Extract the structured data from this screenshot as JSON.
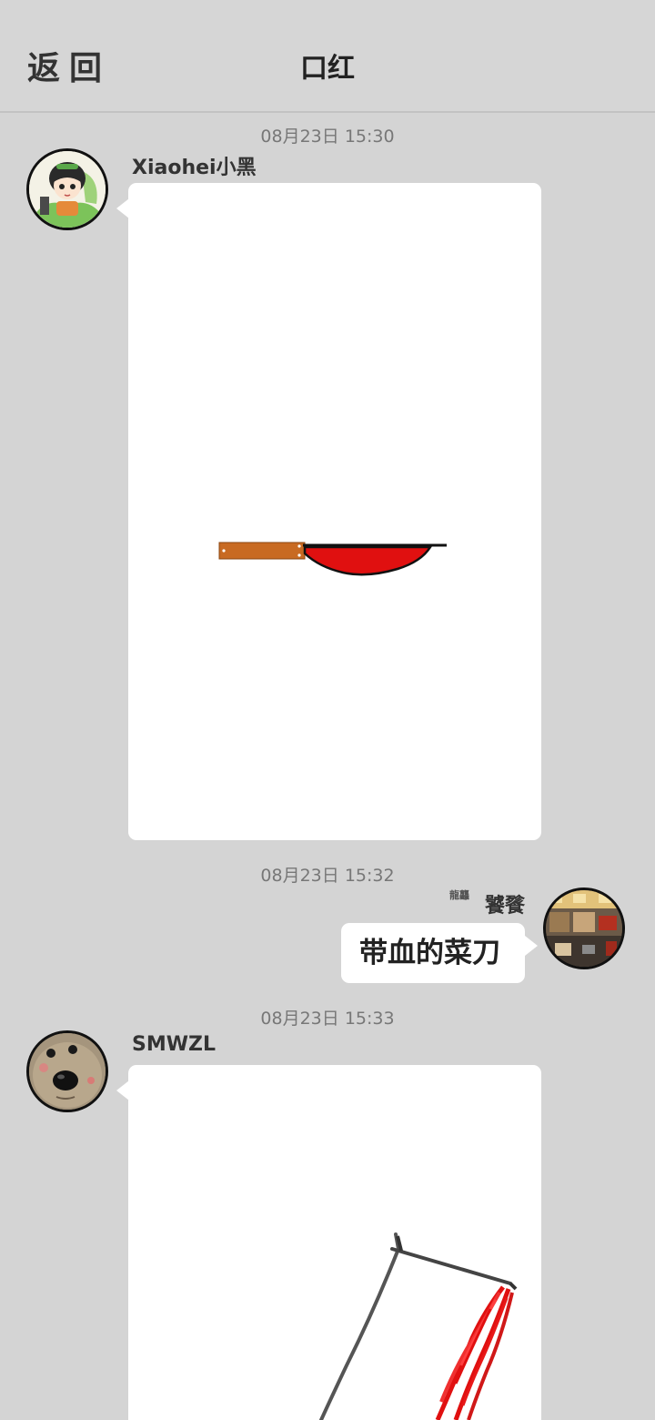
{
  "header": {
    "back_label": "返回",
    "title": "口红"
  },
  "messages": [
    {
      "timestamp": "08月23日  15:30",
      "sender": "Xiaohei小黑",
      "type": "image"
    },
    {
      "timestamp": "08月23日  15:32",
      "sender": "饕餮",
      "badge": "龍龘",
      "type": "text",
      "text": "带血的菜刀"
    },
    {
      "timestamp": "08月23日  15:33",
      "sender": "SMWZL",
      "type": "image"
    }
  ],
  "colors": {
    "background": "#d4d4d4",
    "bubble": "#ffffff",
    "handle": "#c86a22",
    "blood_red": "#e01010"
  },
  "icons": {
    "avatar_1": "anime-girl-avatar",
    "avatar_2": "room-photo-avatar",
    "avatar_3": "plush-toy-avatar"
  }
}
